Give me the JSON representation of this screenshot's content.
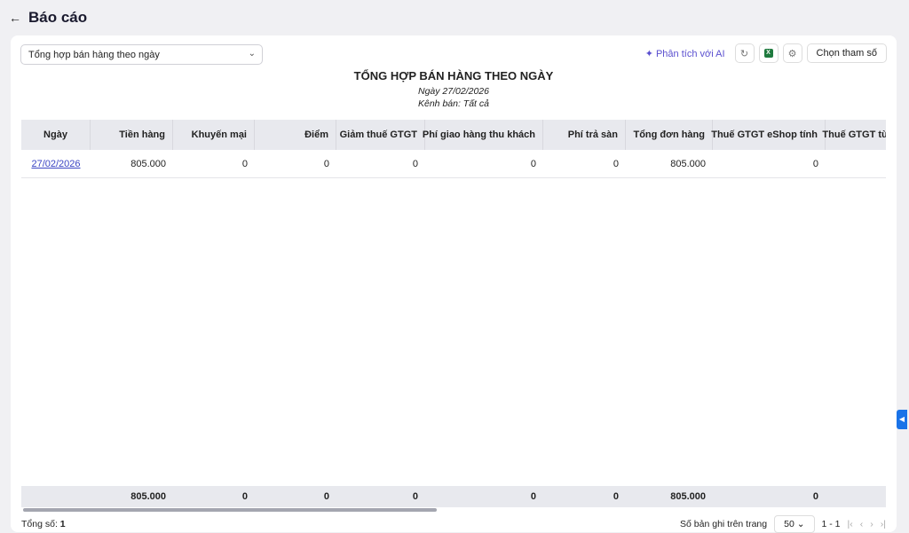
{
  "header": {
    "title": "Báo cáo"
  },
  "report_select": {
    "value": "Tổng hợp bán hàng theo ngày"
  },
  "toolbar": {
    "ai_label": "Phân tích với AI",
    "excel_label": "X",
    "params_label": "Chọn tham số"
  },
  "report": {
    "title": "TỔNG HỢP BÁN HÀNG THEO NGÀY",
    "date": "Ngày 27/02/2026",
    "channel": "Kênh bán: Tất cả"
  },
  "table": {
    "columns": [
      "Ngày",
      "Tiền hàng",
      "Khuyến mại",
      "Điểm",
      "Giảm thuế GTGT",
      "Phí giao hàng thu khách",
      "Phí trả sàn",
      "Tổng đơn hàng",
      "Thuế GTGT eShop tính",
      "Thuế GTGT từ"
    ],
    "rows": [
      [
        "27/02/2026",
        "805.000",
        "0",
        "0",
        "0",
        "0",
        "0",
        "805.000",
        "0",
        ""
      ]
    ],
    "totals": [
      "",
      "805.000",
      "0",
      "0",
      "0",
      "0",
      "0",
      "805.000",
      "0",
      ""
    ]
  },
  "pager": {
    "total_label": "Tổng số:",
    "total": "1",
    "per_page_label": "Số bản ghi trên trang",
    "per_page": "50",
    "range": "1 - 1"
  }
}
